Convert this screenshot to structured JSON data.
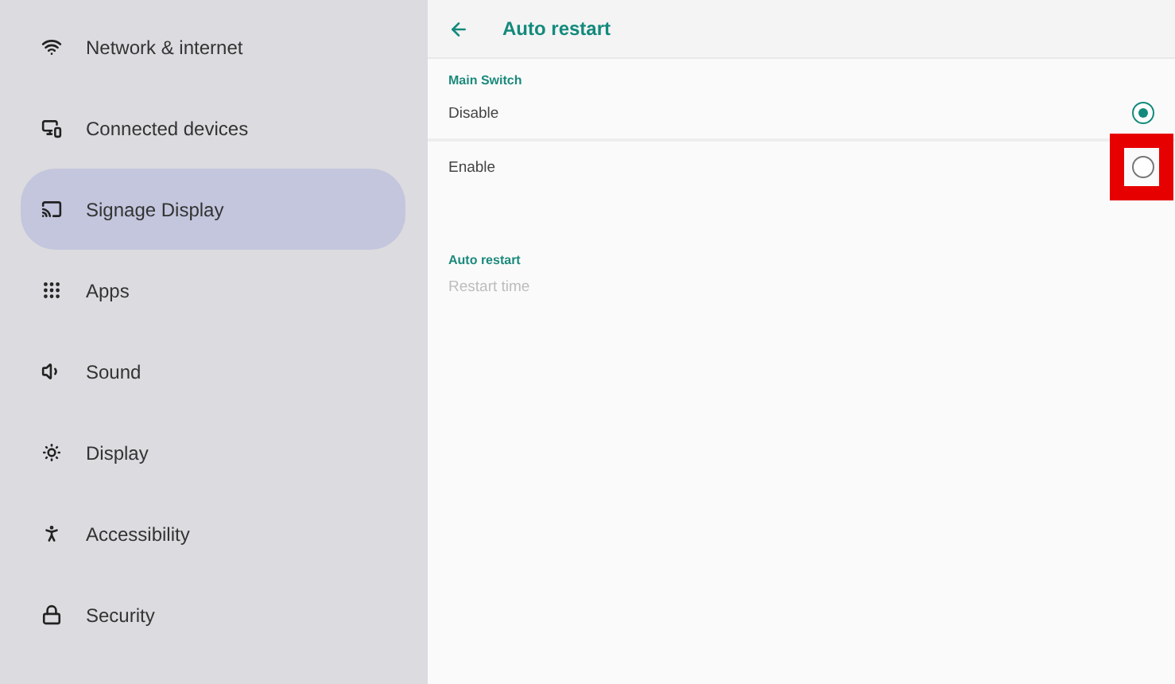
{
  "sidebar": {
    "items": [
      {
        "label": "Network & internet",
        "selected": false
      },
      {
        "label": "Connected devices",
        "selected": false
      },
      {
        "label": "Signage Display",
        "selected": true
      },
      {
        "label": "Apps",
        "selected": false
      },
      {
        "label": "Sound",
        "selected": false
      },
      {
        "label": "Display",
        "selected": false
      },
      {
        "label": "Accessibility",
        "selected": false
      },
      {
        "label": "Security",
        "selected": false
      }
    ]
  },
  "page": {
    "title": "Auto restart",
    "sections": [
      {
        "header": "Main Switch",
        "kind": "radio",
        "options": [
          {
            "label": "Disable",
            "selected": true,
            "highlighted": false
          },
          {
            "label": "Enable",
            "selected": false,
            "highlighted": true
          }
        ]
      },
      {
        "header": "Auto restart",
        "kind": "plain",
        "items": [
          {
            "label": "Restart time",
            "disabled": true
          }
        ]
      }
    ]
  }
}
